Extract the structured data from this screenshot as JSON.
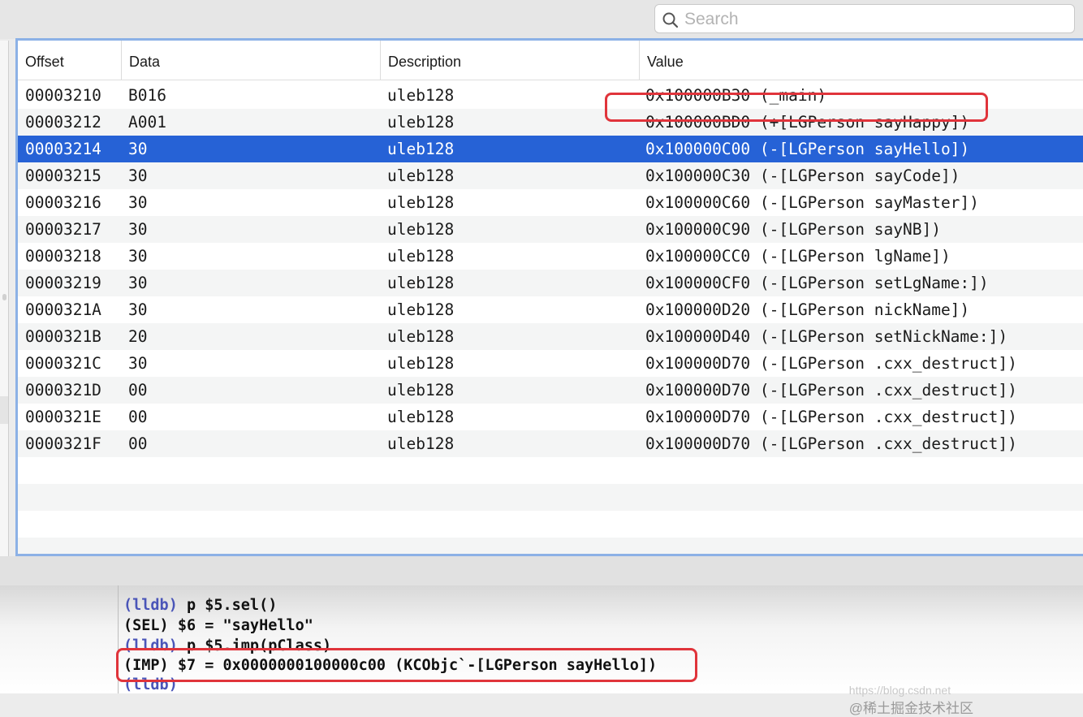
{
  "search": {
    "placeholder": "Search"
  },
  "table": {
    "columns": [
      "Offset",
      "Data",
      "Description",
      "Value"
    ],
    "selected_row_index": 2,
    "rows": [
      {
        "offset": "00003210",
        "data": "B016",
        "description": "uleb128",
        "value": "0x100000B30 (_main)"
      },
      {
        "offset": "00003212",
        "data": "A001",
        "description": "uleb128",
        "value": "0x100000BD0 (+[LGPerson sayHappy])"
      },
      {
        "offset": "00003214",
        "data": "30",
        "description": "uleb128",
        "value": "0x100000C00 (-[LGPerson sayHello])"
      },
      {
        "offset": "00003215",
        "data": "30",
        "description": "uleb128",
        "value": "0x100000C30 (-[LGPerson sayCode])"
      },
      {
        "offset": "00003216",
        "data": "30",
        "description": "uleb128",
        "value": "0x100000C60 (-[LGPerson sayMaster])"
      },
      {
        "offset": "00003217",
        "data": "30",
        "description": "uleb128",
        "value": "0x100000C90 (-[LGPerson sayNB])"
      },
      {
        "offset": "00003218",
        "data": "30",
        "description": "uleb128",
        "value": "0x100000CC0 (-[LGPerson lgName])"
      },
      {
        "offset": "00003219",
        "data": "30",
        "description": "uleb128",
        "value": "0x100000CF0 (-[LGPerson setLgName:])"
      },
      {
        "offset": "0000321A",
        "data": "30",
        "description": "uleb128",
        "value": "0x100000D20 (-[LGPerson nickName])"
      },
      {
        "offset": "0000321B",
        "data": "20",
        "description": "uleb128",
        "value": "0x100000D40 (-[LGPerson setNickName:])"
      },
      {
        "offset": "0000321C",
        "data": "30",
        "description": "uleb128",
        "value": "0x100000D70 (-[LGPerson .cxx_destruct])"
      },
      {
        "offset": "0000321D",
        "data": "00",
        "description": "uleb128",
        "value": "0x100000D70 (-[LGPerson .cxx_destruct])"
      },
      {
        "offset": "0000321E",
        "data": "00",
        "description": "uleb128",
        "value": "0x100000D70 (-[LGPerson .cxx_destruct])"
      },
      {
        "offset": "0000321F",
        "data": "00",
        "description": "uleb128",
        "value": "0x100000D70 (-[LGPerson .cxx_destruct])"
      }
    ],
    "empty_rows": 4
  },
  "console": {
    "prompt": "(lldb)",
    "lines": [
      {
        "prompt": "(lldb)",
        "text": " p $5.sel()"
      },
      {
        "prompt": "",
        "text": "(SEL) $6 = \"sayHello\""
      },
      {
        "prompt": "(lldb)",
        "text": " p $5.imp(pClass)"
      },
      {
        "prompt": "",
        "text": "(IMP) $7 = 0x0000000100000c00 (KCObjc`-[LGPerson sayHello])"
      },
      {
        "prompt": "(lldb)",
        "text": ""
      }
    ]
  },
  "watermark": {
    "url": "https://blog.csdn.net",
    "site": "@稀土掘金技术社区"
  },
  "colors": {
    "selection": "#2662d6",
    "highlight_box": "#e0343b",
    "table_border": "#8cb1e6"
  },
  "icons": {
    "search": "magnifier-icon"
  }
}
